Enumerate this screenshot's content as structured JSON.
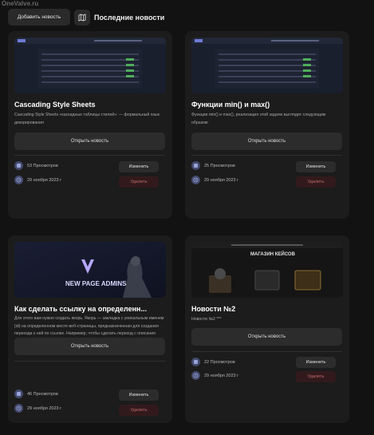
{
  "watermark": "OneValve.ru",
  "header": {
    "add_label": "Добавить новость",
    "section_title": "Последние новости"
  },
  "cards": [
    {
      "title": "Cascading Style Sheets",
      "desc": "Cascading Style Sheets «каскадные таблицы стилей»: — формальный язык декорирования",
      "open_label": "Открыть новость",
      "views": "53 Просмотров",
      "date": "29 ноября 2023 г",
      "edit_label": "Изменить",
      "delete_label": "Удалить",
      "thumb_icon": "admin-table-preview"
    },
    {
      "title": "Функции min() и max()",
      "desc": "Функции min() и max(), реализация этой задачи выглядит следующим образом:",
      "open_label": "Открыть новость",
      "views": "25 Просмотров",
      "date": "29 ноября 2023 г",
      "edit_label": "Изменить",
      "delete_label": "Удалить",
      "thumb_icon": "admin-table-preview"
    },
    {
      "title": "Как сделать ссылку на определенн...",
      "desc": "Для этого вам нужно создать якорь. Якорь — закладка с уникальным именем (id) на определенном месте веб-страницы, предназначенная для создания перехода к ней по ссылке. Например, чтобы сделать переход с описания компании на контакты:",
      "open_label": "Открыть новость",
      "views": "46 Просмотров",
      "date": "29 ноября 2023 г",
      "edit_label": "Изменить",
      "delete_label": "Удалить",
      "thumb_text": "NEW PAGE ADMINS"
    },
    {
      "title": "Новости №2",
      "desc": "Новости №2 ***",
      "open_label": "Открыть новость",
      "views": "22 Просмотров",
      "date": "29 ноября 2023 г",
      "edit_label": "Изменить",
      "delete_label": "Удалить",
      "thumb_text": "МАГАЗИН КЕЙСОВ"
    }
  ],
  "colors": {
    "background": "#121212",
    "card": "#1c1c1c",
    "button": "#2c2c2c",
    "delete_bg": "#321a1c",
    "delete_text": "#c06a6a",
    "icon_accent": "#444b6e"
  }
}
